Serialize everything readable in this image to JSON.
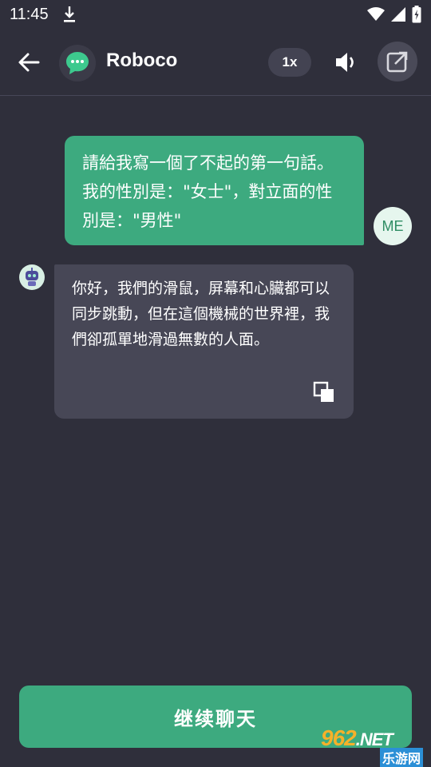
{
  "status": {
    "time": "11:45"
  },
  "header": {
    "title": "Roboco",
    "speed_label": "1x"
  },
  "messages": {
    "user_text": "請給我寫一個了不起的第一句話。 我的性別是：\"女士\"，對立面的性別是：\"男性\"",
    "user_avatar": "ME",
    "bot_text": "你好，我們的滑鼠，屏幕和心臟都可以同步跳動，但在這個機械的世界裡，我們卻孤單地滑過無數的人面。"
  },
  "footer": {
    "continue_label": "继续聊天"
  },
  "watermark": {
    "brand": "962",
    "suffix": ".NET",
    "site": "乐游网"
  },
  "colors": {
    "background": "#2f2f3b",
    "accent": "#3daa7f",
    "bot_bubble": "#474756"
  },
  "icons": [
    "download-icon",
    "wifi-icon",
    "signal-icon",
    "battery-icon",
    "back-arrow-icon",
    "chat-bubble-icon",
    "volume-icon",
    "share-icon",
    "robot-icon",
    "copy-icon"
  ]
}
